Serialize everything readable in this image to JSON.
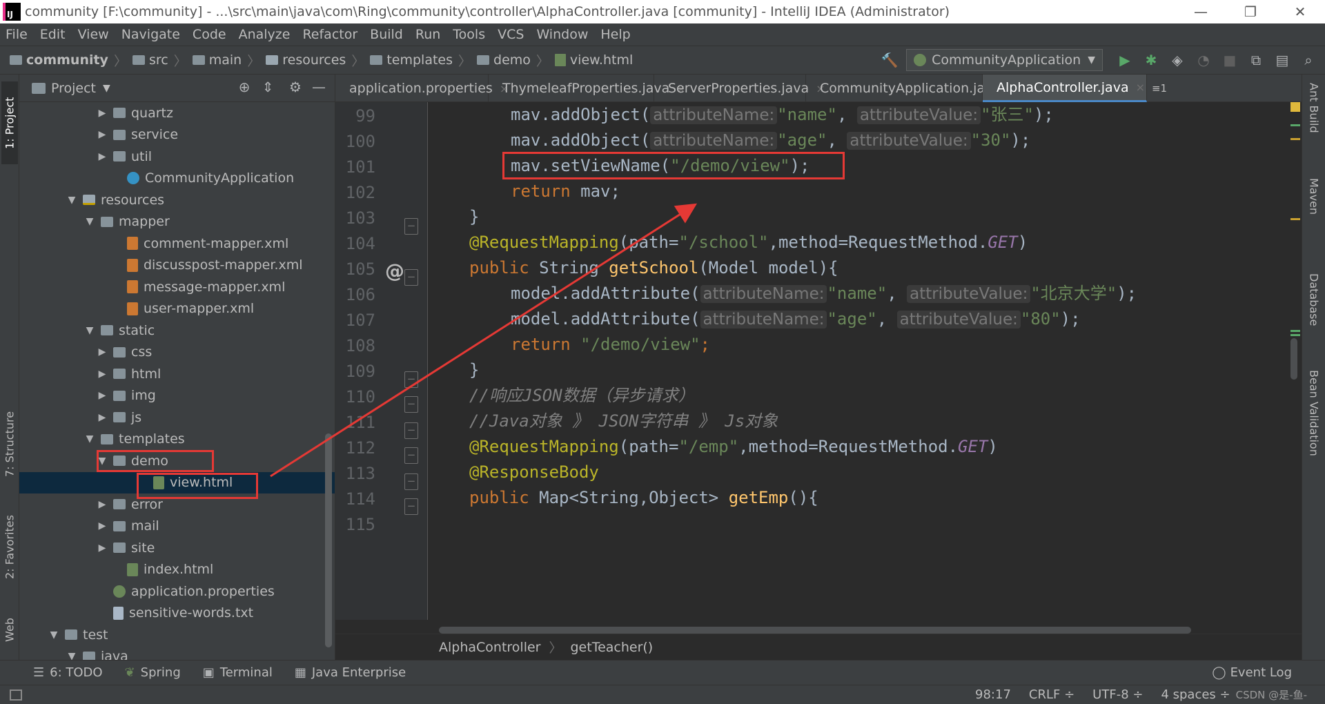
{
  "window": {
    "title": "community [F:\\community] - ...\\src\\main\\java\\com\\Ring\\community\\controller\\AlphaController.java [community] - IntelliJ IDEA (Administrator)",
    "app_icon_text": "IJ",
    "minimize": "—",
    "restore": "❐",
    "close": "✕"
  },
  "menu": [
    "File",
    "Edit",
    "View",
    "Navigate",
    "Code",
    "Analyze",
    "Refactor",
    "Build",
    "Run",
    "Tools",
    "VCS",
    "Window",
    "Help"
  ],
  "nav": {
    "crumbs": [
      "community",
      "src",
      "main",
      "resources",
      "templates",
      "demo",
      "view.html"
    ],
    "run_config": "CommunityApplication",
    "run_config_arrow": "▼"
  },
  "left_stripe": {
    "project": "1: Project",
    "structure": "7: Structure",
    "favorites": "2: Favorites",
    "web": "Web"
  },
  "project_panel": {
    "title": "Project",
    "title_arrow": "▼",
    "tree": [
      {
        "label": "quartz",
        "arrow": "▶",
        "icon": "folder"
      },
      {
        "label": "service",
        "arrow": "▶",
        "icon": "folder"
      },
      {
        "label": "util",
        "arrow": "▶",
        "icon": "folder"
      },
      {
        "label": "CommunityApplication",
        "arrow": "",
        "icon": "java"
      },
      {
        "label": "resources",
        "arrow": "▼",
        "icon": "folder-res"
      },
      {
        "label": "mapper",
        "arrow": "▼",
        "icon": "folder"
      },
      {
        "label": "comment-mapper.xml",
        "arrow": "",
        "icon": "xml"
      },
      {
        "label": "discusspost-mapper.xml",
        "arrow": "",
        "icon": "xml"
      },
      {
        "label": "message-mapper.xml",
        "arrow": "",
        "icon": "xml"
      },
      {
        "label": "user-mapper.xml",
        "arrow": "",
        "icon": "xml"
      },
      {
        "label": "static",
        "arrow": "▼",
        "icon": "folder"
      },
      {
        "label": "css",
        "arrow": "▶",
        "icon": "folder"
      },
      {
        "label": "html",
        "arrow": "▶",
        "icon": "folder"
      },
      {
        "label": "img",
        "arrow": "▶",
        "icon": "folder"
      },
      {
        "label": "js",
        "arrow": "▶",
        "icon": "folder"
      },
      {
        "label": "templates",
        "arrow": "▼",
        "icon": "folder"
      },
      {
        "label": "demo",
        "arrow": "▼",
        "icon": "folder"
      },
      {
        "label": "view.html",
        "arrow": "",
        "icon": "html"
      },
      {
        "label": "error",
        "arrow": "▶",
        "icon": "folder"
      },
      {
        "label": "mail",
        "arrow": "▶",
        "icon": "folder"
      },
      {
        "label": "site",
        "arrow": "▶",
        "icon": "folder"
      },
      {
        "label": "index.html",
        "arrow": "",
        "icon": "html"
      },
      {
        "label": "application.properties",
        "arrow": "",
        "icon": "props"
      },
      {
        "label": "sensitive-words.txt",
        "arrow": "",
        "icon": "txt"
      },
      {
        "label": "test",
        "arrow": "▼",
        "icon": "folder"
      },
      {
        "label": "java",
        "arrow": "▼",
        "icon": "folder"
      }
    ]
  },
  "tabs": [
    {
      "label": "application.properties",
      "icon": "p",
      "close": "×"
    },
    {
      "label": "ThymeleafProperties.java",
      "icon": "c",
      "close": "×"
    },
    {
      "label": "ServerProperties.java",
      "icon": "c",
      "close": "×"
    },
    {
      "label": "CommunityApplication.java",
      "icon": "c",
      "close": "×"
    },
    {
      "label": "AlphaController.java",
      "icon": "c",
      "close": "×"
    }
  ],
  "tab_overflow": "≡1",
  "code": {
    "line_numbers": [
      "99",
      "100",
      "101",
      "102",
      "103",
      "104",
      "105",
      "106",
      "107",
      "108",
      "109",
      "110",
      "111",
      "112",
      "113",
      "114",
      "115"
    ],
    "hints": {
      "attribute_name": "attributeName:",
      "attribute_value": "attributeValue:"
    },
    "l99": {
      "call": "mav.addObject(",
      "name": "\"name\"",
      "comma": ", ",
      "value": "\"张三\"",
      "end": ");"
    },
    "l100": {
      "call": "mav.addObject(",
      "name": "\"age\"",
      "comma": ", ",
      "value": "\"30\"",
      "end": ");"
    },
    "l101": {
      "call": "mav.setViewName(",
      "str": "\"/demo/view\"",
      "end": ");"
    },
    "l102": {
      "kw": "return",
      "rest": " mav;"
    },
    "l103": "}",
    "l104": {
      "ann": "@RequestMapping",
      "open": "(path=",
      "path": "\"/school\"",
      "mid": ",method=RequestMethod.",
      "const": "GET",
      "close": ")"
    },
    "l105": {
      "kw": "public",
      "type": " String ",
      "fn": "getSchool",
      "params": "(Model model){"
    },
    "l106": {
      "call": "model.addAttribute(",
      "name": "\"name\"",
      "comma": ", ",
      "value": "\"北京大学\"",
      "end": ");"
    },
    "l107": {
      "call": "model.addAttribute(",
      "name": "\"age\"",
      "comma": ", ",
      "value": "\"80\"",
      "end": ");"
    },
    "l108": {
      "kw": "return",
      "sp": " ",
      "str": "\"/demo/view\"",
      "end": ";"
    },
    "l109": "}",
    "l110": "//响应JSON数据（异步请求）",
    "l111": "//Java对象 》 JSON字符串 》 Js对象",
    "l112": {
      "ann": "@RequestMapping",
      "open": "(path=",
      "path": "\"/emp\"",
      "mid": ",method=RequestMethod.",
      "const": "GET",
      "close": ")"
    },
    "l113": "@ResponseBody",
    "l114": {
      "kw": "public",
      "type": " Map<String,Object> ",
      "fn": "getEmp",
      "params": "(){"
    },
    "at_icon": "@"
  },
  "code_crumbs": [
    "AlphaController",
    "getTeacher()"
  ],
  "right_stripe": [
    "Ant Build",
    "Maven",
    "Database",
    "Bean Validation"
  ],
  "bottom_tools": [
    {
      "label": "6: TODO",
      "icon": "☰"
    },
    {
      "label": "Spring",
      "icon": "❦"
    },
    {
      "label": "Terminal",
      "icon": "▣"
    },
    {
      "label": "Java Enterprise",
      "icon": "▦"
    }
  ],
  "event_log": "Event Log",
  "status": {
    "position": "98:17",
    "line_sep": "CRLF ÷",
    "encoding": "UTF-8 ÷",
    "indent": "4 spaces ÷",
    "watermark": "CSDN @是-鱼-"
  },
  "colors": {
    "background": "#2b2b2b",
    "panel": "#3c3f41",
    "keyword": "#cc7832",
    "string": "#6a8759",
    "annotation": "#bbb529",
    "function": "#ffc66d",
    "highlight_box": "#e53935"
  }
}
